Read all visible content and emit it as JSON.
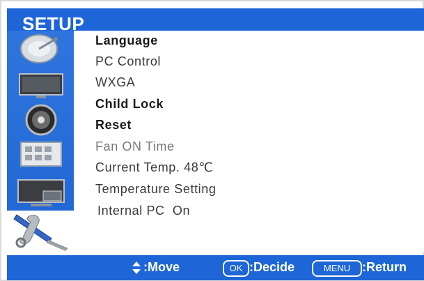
{
  "title": "SETUP",
  "menu_items": [
    {
      "label": "Language"
    },
    {
      "label": "PC Control"
    },
    {
      "label": "WXGA"
    },
    {
      "label": "Child Lock"
    },
    {
      "label": "Reset"
    },
    {
      "label": "Fan ON Time"
    },
    {
      "label": "Current Temp. 48℃"
    },
    {
      "label": "Temperature Setting"
    },
    {
      "label": "Internal PC  On"
    }
  ],
  "sidebar_icons": [
    "satellite-dish-icon",
    "screen-picture-icon",
    "speaker-icon",
    "timer-icon",
    "multi-screen-icon",
    "tools-icon"
  ],
  "bottom_bar": {
    "move_label": ":Move",
    "ok_key": "OK",
    "decide_label": ":Decide",
    "menu_key": "MENU",
    "return_label": ":Return"
  },
  "colors": {
    "accent": "#1e66d8",
    "text": "#1a1a1a"
  }
}
